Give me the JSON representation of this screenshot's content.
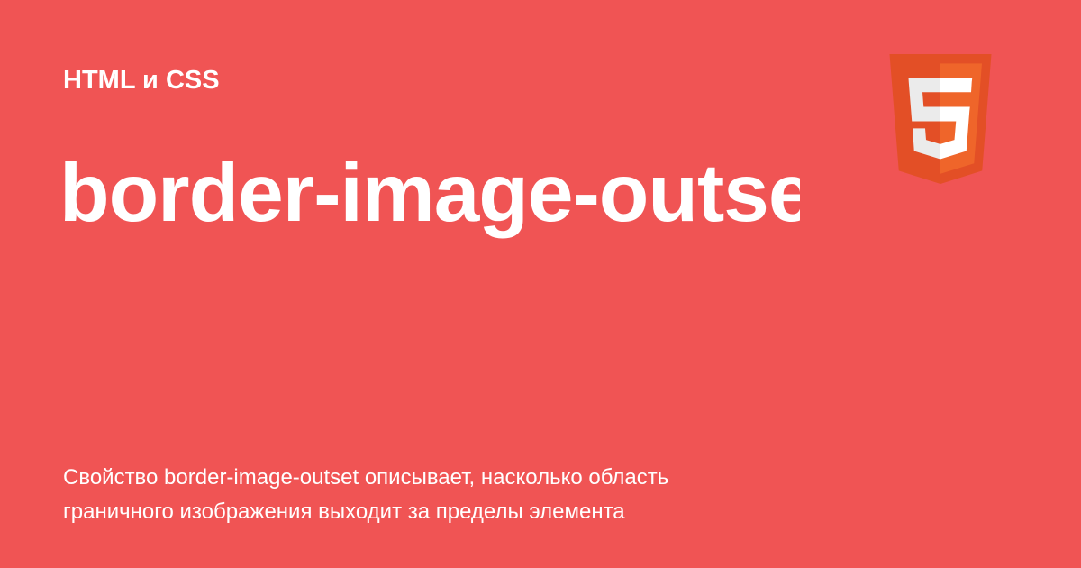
{
  "card": {
    "category": "HTML и CSS",
    "title": "border-image-outse",
    "description": [
      "Свойство border-image-outset описывает, насколько область",
      "граничного изображения выходит за пределы элемента"
    ]
  },
  "logo": {
    "icon": "html5-logo-icon",
    "colors": {
      "shield_dark": "#e34f26",
      "shield_light": "#ef652a",
      "five": "#ffffff",
      "five_shadow": "#ebebeb"
    }
  },
  "colors": {
    "background": "#f05454",
    "text": "#ffffff"
  }
}
